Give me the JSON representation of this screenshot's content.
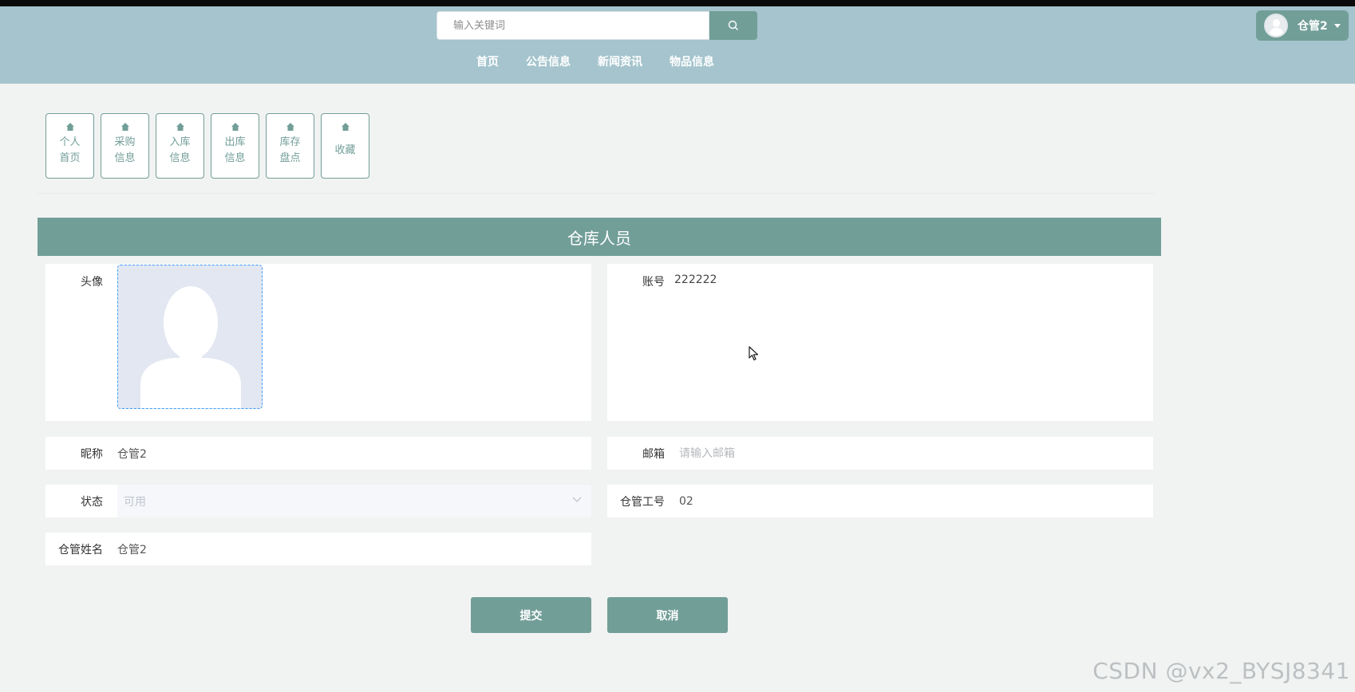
{
  "header": {
    "search": {
      "placeholder": "输入关键词"
    },
    "nav": [
      "首页",
      "公告信息",
      "新闻资讯",
      "物品信息"
    ],
    "user": {
      "name": "仓管2"
    }
  },
  "quick_nav": [
    {
      "label": "个人首页",
      "icon": "home-icon"
    },
    {
      "label": "采购信息",
      "icon": "home-icon"
    },
    {
      "label": "入库信息",
      "icon": "home-icon"
    },
    {
      "label": "出库信息",
      "icon": "home-icon"
    },
    {
      "label": "库存盘点",
      "icon": "home-icon"
    },
    {
      "label": "收藏",
      "icon": "home-icon"
    }
  ],
  "section": {
    "title": "仓库人员"
  },
  "form": {
    "avatar_label": "头像",
    "account_label": "账号",
    "account_value": "222222",
    "nickname_label": "昵称",
    "nickname_value": "仓管2",
    "email_label": "邮箱",
    "email_placeholder": "请输入邮箱",
    "status_label": "状态",
    "status_value": "可用",
    "staff_no_label": "仓管工号",
    "staff_no_value": "02",
    "staff_name_label": "仓管姓名",
    "staff_name_value": "仓管2"
  },
  "buttons": {
    "submit": "提交",
    "cancel": "取消"
  },
  "watermark": "CSDN @vx2_BYSJ8341",
  "colors": {
    "header_bg": "#a5c4cd",
    "accent": "#729e98",
    "page_bg": "#f1f3f2"
  }
}
